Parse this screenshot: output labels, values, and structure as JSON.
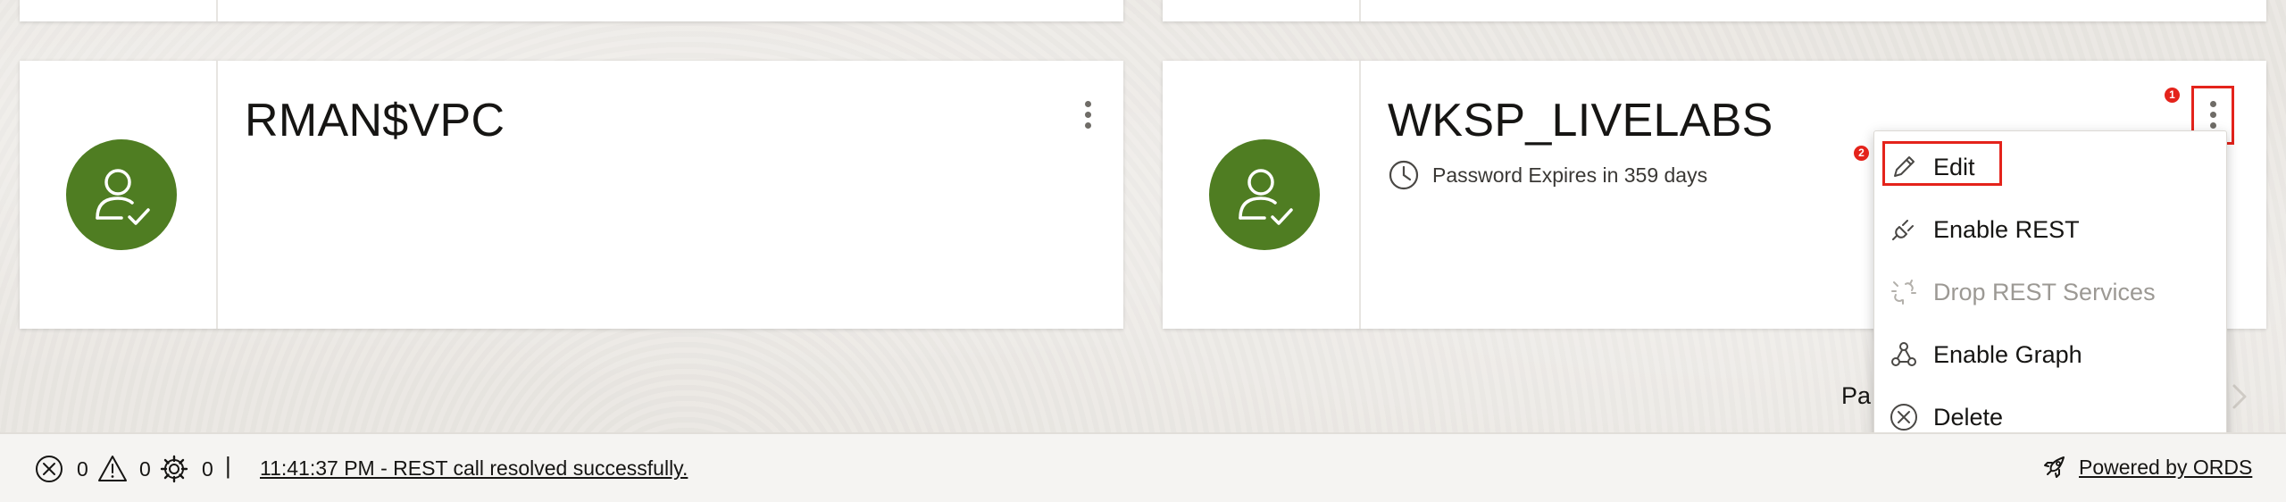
{
  "cards": [
    {
      "title": "RMAN$VPC",
      "expires": ""
    },
    {
      "title": "WKSP_LIVELABS",
      "expires": "Password Expires in 359 days"
    }
  ],
  "badges": {
    "kebab": "1",
    "edit": "2"
  },
  "menu": {
    "items": [
      {
        "label": "Edit",
        "icon": "pencil-icon",
        "disabled": false
      },
      {
        "label": "Enable REST",
        "icon": "plug-icon",
        "disabled": false
      },
      {
        "label": "Drop REST Services",
        "icon": "broken-plug-icon",
        "disabled": true
      },
      {
        "label": "Enable Graph",
        "icon": "graph-icon",
        "disabled": false
      },
      {
        "label": "Delete",
        "icon": "delete-circle-icon",
        "disabled": false
      }
    ]
  },
  "pager": {
    "label": "Pa"
  },
  "status": {
    "errors": "0",
    "warnings": "0",
    "tasks": "0",
    "separator": "|",
    "message": "11:41:37 PM - REST call resolved successfully.",
    "powered": "Powered by ORDS"
  },
  "colors": {
    "avatar": "#4f7d22",
    "highlight": "#e4231b",
    "background": "#ebe8e3",
    "disabled_text": "#9c9994"
  }
}
